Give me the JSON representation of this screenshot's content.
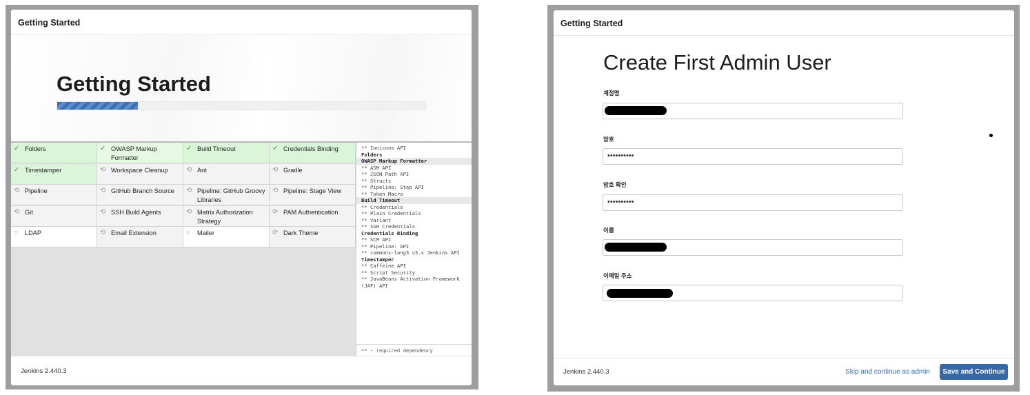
{
  "left_dialog": {
    "header_title": "Getting Started",
    "hero_title": "Getting Started",
    "progress": 0.22,
    "plugins": [
      {
        "name": "Folders",
        "status": "installed",
        "icon": "check-icon",
        "glyph": "✓"
      },
      {
        "name": "OWASP Markup Formatter",
        "status": "installed",
        "icon": "check-icon",
        "glyph": "✓"
      },
      {
        "name": "Build Timeout",
        "status": "installed",
        "icon": "check-icon",
        "glyph": "✓"
      },
      {
        "name": "Credentials Binding",
        "status": "installed",
        "icon": "check-icon",
        "glyph": "✓"
      },
      {
        "name": "Timestamper",
        "status": "installed",
        "icon": "check-icon",
        "glyph": "✓"
      },
      {
        "name": "Workspace Cleanup",
        "status": "pending",
        "icon": "refresh-icon",
        "glyph": "⟲"
      },
      {
        "name": "Ant",
        "status": "pending",
        "icon": "refresh-icon",
        "glyph": "⟲"
      },
      {
        "name": "Gradle",
        "status": "pending",
        "icon": "refresh-icon",
        "glyph": "⟲"
      },
      {
        "name": "Pipeline",
        "status": "pending",
        "icon": "refresh-icon",
        "glyph": "⟲"
      },
      {
        "name": "GitHub Branch Source",
        "status": "pending",
        "icon": "refresh-icon",
        "glyph": "⟲"
      },
      {
        "name": "Pipeline: GitHub Groovy Libraries",
        "status": "pending",
        "icon": "refresh-icon",
        "glyph": "⟲"
      },
      {
        "name": "Pipeline: Stage View",
        "status": "pending",
        "icon": "refresh-icon",
        "glyph": "⟲"
      },
      {
        "name": "Git",
        "status": "pending",
        "icon": "refresh-icon",
        "glyph": "⟲"
      },
      {
        "name": "SSH Build Agents",
        "status": "pending",
        "icon": "refresh-icon",
        "glyph": "⟲"
      },
      {
        "name": "Matrix Authorization Strategy",
        "status": "pending",
        "icon": "refresh-icon",
        "glyph": "⟲"
      },
      {
        "name": "PAM Authentication",
        "status": "pending",
        "icon": "refresh-icon",
        "glyph": "⟳"
      },
      {
        "name": "LDAP",
        "status": "idle",
        "icon": "circle-icon",
        "glyph": "○"
      },
      {
        "name": "Email Extension",
        "status": "pending",
        "icon": "refresh-icon",
        "glyph": "⟲"
      },
      {
        "name": "Mailer",
        "status": "idle",
        "icon": "circle-icon",
        "glyph": "○"
      },
      {
        "name": "Dark Theme",
        "status": "pending",
        "icon": "refresh-icon",
        "glyph": "⟳"
      }
    ],
    "log": [
      {
        "text": "** Ionicons API",
        "head": false,
        "hl": false
      },
      {
        "text": "Folders",
        "head": true,
        "hl": false
      },
      {
        "text": "OWASP Markup Formatter",
        "head": true,
        "hl": true
      },
      {
        "text": "** ASM API",
        "head": false,
        "hl": false
      },
      {
        "text": "** JSON Path API",
        "head": false,
        "hl": false
      },
      {
        "text": "** Structs",
        "head": false,
        "hl": false
      },
      {
        "text": "** Pipeline: Step API",
        "head": false,
        "hl": false
      },
      {
        "text": "** Token Macro",
        "head": false,
        "hl": false
      },
      {
        "text": "Build Timeout",
        "head": true,
        "hl": true
      },
      {
        "text": "** Credentials",
        "head": false,
        "hl": false
      },
      {
        "text": "** Plain Credentials",
        "head": false,
        "hl": false
      },
      {
        "text": "** Variant",
        "head": false,
        "hl": false
      },
      {
        "text": "** SSH Credentials",
        "head": false,
        "hl": false
      },
      {
        "text": "Credentials Binding",
        "head": true,
        "hl": false
      },
      {
        "text": "** SCM API",
        "head": false,
        "hl": false
      },
      {
        "text": "** Pipeline: API",
        "head": false,
        "hl": false
      },
      {
        "text": "** commons-lang3 v3.x Jenkins API",
        "head": false,
        "hl": false
      },
      {
        "text": "Timestamper",
        "head": true,
        "hl": false
      },
      {
        "text": "** Caffeine API",
        "head": false,
        "hl": false
      },
      {
        "text": "** Script Security",
        "head": false,
        "hl": false
      },
      {
        "text": "** JavaBeans Activation Framework (JAF) API",
        "head": false,
        "hl": false
      }
    ],
    "log_footer": "** - required dependency",
    "footer_version": "Jenkins 2.440.3"
  },
  "right_dialog": {
    "header_title": "Getting Started",
    "form_title": "Create First Admin User",
    "fields": {
      "username": {
        "label": "계정명",
        "value": ""
      },
      "password": {
        "label": "암호",
        "value": "••••••••••"
      },
      "password_confirm": {
        "label": "암호 확인",
        "value": "••••••••••"
      },
      "fullname": {
        "label": "이름",
        "value": ""
      },
      "email": {
        "label": "이메일 주소",
        "value": ""
      }
    },
    "footer_version": "Jenkins 2.440.3",
    "skip_label": "Skip and continue as admin",
    "save_label": "Save and Continue"
  }
}
